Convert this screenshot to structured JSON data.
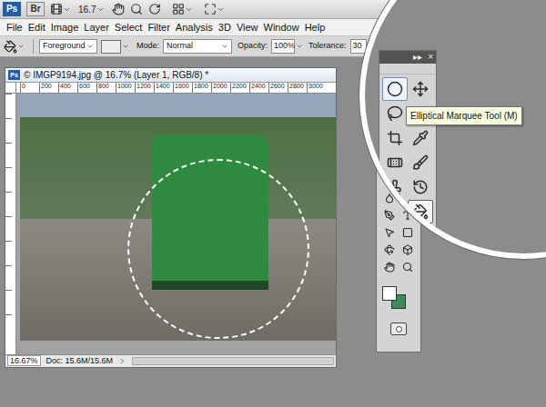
{
  "app_bar": {
    "logo": "Ps",
    "bridge": "Br",
    "zoom": "16.7"
  },
  "menu": [
    "File",
    "Edit",
    "Image",
    "Layer",
    "Select",
    "Filter",
    "Analysis",
    "3D",
    "View",
    "Window",
    "Help"
  ],
  "options_bar": {
    "fill": "Foreground",
    "mode_label": "Mode:",
    "mode": "Normal",
    "opacity_label": "Opacity:",
    "opacity": "100%",
    "tolerance_label": "Tolerance:",
    "tolerance": "30",
    "checkbox_checked": true
  },
  "document": {
    "icon_label": "Ps",
    "title": "© IMGP9194.jpg @ 16.7% (Layer 1, RGB/8) *",
    "ruler": [
      "0",
      "200",
      "400",
      "600",
      "800",
      "1000",
      "1200",
      "1400",
      "1600",
      "1800",
      "2000",
      "2200",
      "2400",
      "2600",
      "2800",
      "3000"
    ],
    "zoom": "16.67%",
    "info": "Doc: 15.6M/15.6M",
    "selection_active": true
  },
  "toolbox": {
    "expand": "▸▸",
    "close": "×",
    "tools": [
      {
        "selected": false,
        "hovered": true
      },
      {
        "selected": false,
        "hovered": false
      },
      {
        "selected": false,
        "hovered": false
      },
      {
        "selected": false,
        "hovered": false
      },
      {
        "selected": false,
        "hovered": false
      },
      {
        "selected": false,
        "hovered": false
      },
      {
        "selected": false,
        "hovered": false
      },
      {
        "selected": false,
        "hovered": false
      },
      {
        "selected": false,
        "hovered": false
      },
      {
        "selected": false,
        "hovered": false
      },
      {
        "selected": false,
        "hovered": false
      },
      {
        "selected": true,
        "hovered": false
      },
      {
        "selected": false,
        "hovered": false
      },
      {
        "selected": false,
        "hovered": false
      },
      {
        "selected": false,
        "hovered": false
      },
      {
        "selected": false,
        "hovered": false
      },
      {
        "selected": false,
        "hovered": false
      },
      {
        "selected": false,
        "hovered": false
      },
      {
        "selected": false,
        "hovered": false
      },
      {
        "selected": false,
        "hovered": false
      },
      {
        "selected": false,
        "hovered": false
      },
      {
        "selected": false,
        "hovered": false
      }
    ],
    "foreground": "#ffffff",
    "background": "#3e8a5c"
  },
  "tooltip": "Elliptical Marquee Tool (M)"
}
